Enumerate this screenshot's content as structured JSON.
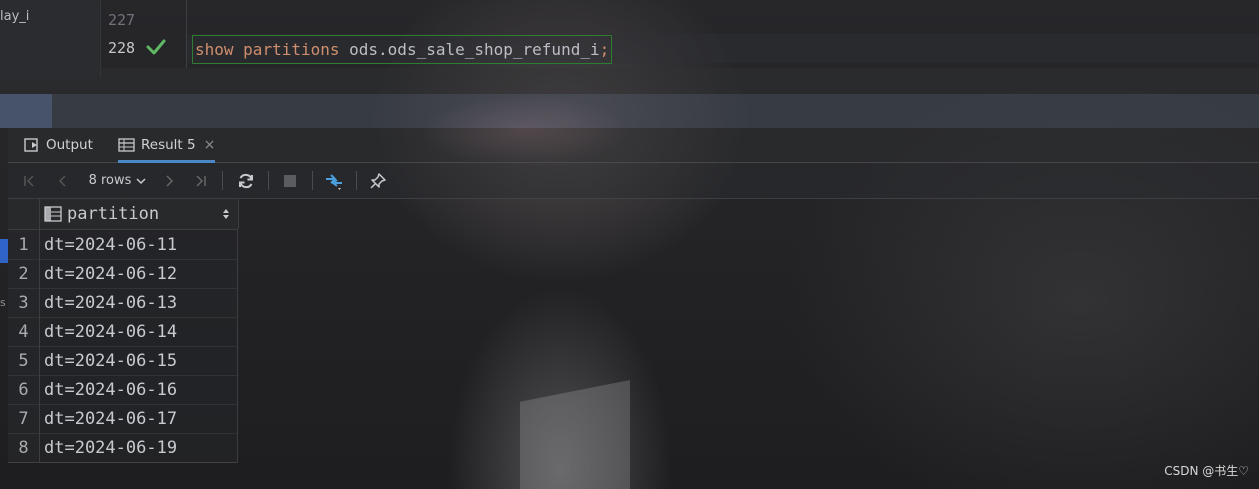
{
  "project": {
    "file_label": "lay_i",
    "side_letter": "s"
  },
  "editor": {
    "line_numbers": [
      "227",
      "228"
    ],
    "code": {
      "keyword1": "show",
      "keyword2": "partitions",
      "identifier": "ods.ods_sale_shop_refund_i",
      "terminator": ";"
    }
  },
  "tool_window": {
    "tabs": [
      {
        "label": "Output",
        "icon": "output-icon"
      },
      {
        "label": "Result 5",
        "icon": "table-icon",
        "active": true,
        "close": "×"
      }
    ],
    "toolbar": {
      "rows_label": "8 rows"
    }
  },
  "result_grid": {
    "column": "partition",
    "rows": [
      {
        "n": "1",
        "value": "dt=2024-06-11"
      },
      {
        "n": "2",
        "value": "dt=2024-06-12"
      },
      {
        "n": "3",
        "value": "dt=2024-06-13"
      },
      {
        "n": "4",
        "value": "dt=2024-06-14"
      },
      {
        "n": "5",
        "value": "dt=2024-06-15"
      },
      {
        "n": "6",
        "value": "dt=2024-06-16"
      },
      {
        "n": "7",
        "value": "dt=2024-06-17"
      },
      {
        "n": "8",
        "value": "dt=2024-06-19"
      }
    ]
  },
  "watermark": "CSDN @书生♡",
  "colors": {
    "keyword": "#cf8e6d",
    "success": "#5fb865",
    "tab_underline": "#4a88c7",
    "selection": "#3574f0"
  }
}
